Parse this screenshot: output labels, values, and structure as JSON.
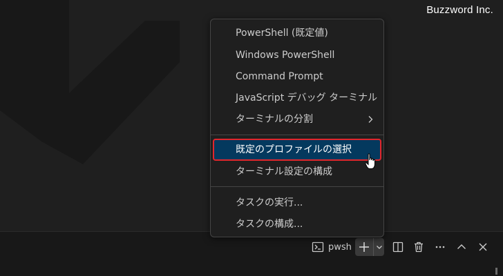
{
  "brand": "Buzzword Inc.",
  "menu": {
    "items": [
      {
        "label": "PowerShell (既定値)"
      },
      {
        "label": "Windows PowerShell"
      },
      {
        "label": "Command Prompt"
      },
      {
        "label": "JavaScript デバッグ ターミナル"
      },
      {
        "label": "ターミナルの分割",
        "has_submenu": true
      },
      {
        "label": "既定のプロファイルの選択",
        "selected": true
      },
      {
        "label": "ターミナル設定の構成"
      },
      {
        "label": "タスクの実行..."
      },
      {
        "label": "タスクの構成..."
      }
    ]
  },
  "panel": {
    "terminal_tab_label": "pwsh"
  },
  "colors": {
    "editor_background": "#1f1f1f",
    "menu_background": "#1f1f1f",
    "selected_item_background": "#04395e",
    "highlight_border": "#e2262c",
    "text": "#cccccc"
  },
  "icons": [
    "terminal-icon",
    "plus-icon",
    "chevron-down-icon",
    "split-panel-icon",
    "trash-icon",
    "more-icon",
    "chevron-up-icon",
    "close-icon",
    "chevron-right-icon",
    "hand-cursor-icon"
  ]
}
